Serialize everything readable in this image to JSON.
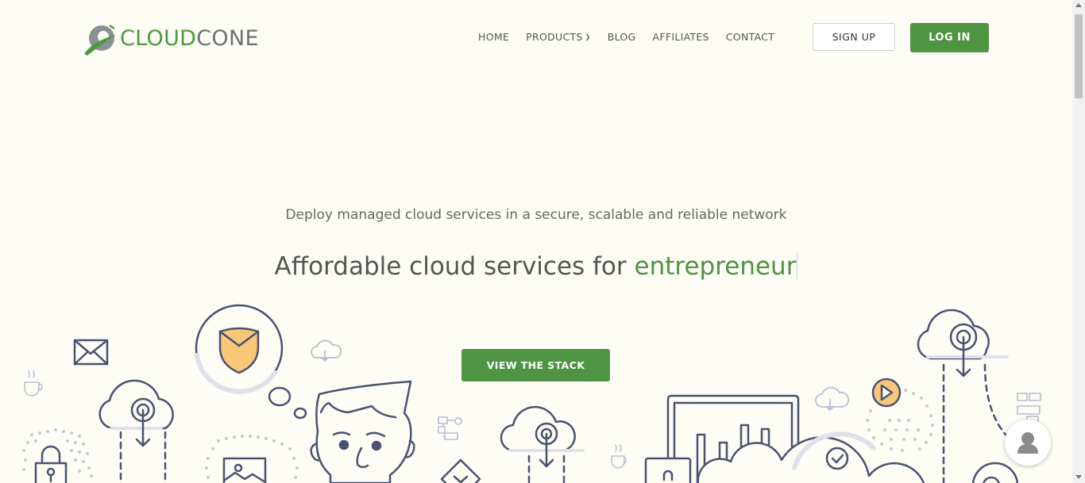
{
  "brand": {
    "name_part1": "CLOUD",
    "name_part2": "CONE"
  },
  "nav": [
    {
      "label": "HOME"
    },
    {
      "label": "PRODUCTS",
      "has_dropdown": true
    },
    {
      "label": "BLOG"
    },
    {
      "label": "AFFILIATES"
    },
    {
      "label": "CONTACT"
    }
  ],
  "auth": {
    "signup_label": "SIGN UP",
    "login_label": "LOG IN"
  },
  "hero": {
    "subtitle": "Deploy managed cloud services in a secure, scalable and reliable network",
    "headline_static": "Affordable cloud services for ",
    "headline_highlight": "entrepreneur",
    "cta_label": "VIEW THE STACK"
  },
  "colors": {
    "brand_green": "#4e9442",
    "background": "#fdfcf5",
    "illustration_stroke": "#4b5270",
    "illustration_accent": "#f8c778"
  }
}
